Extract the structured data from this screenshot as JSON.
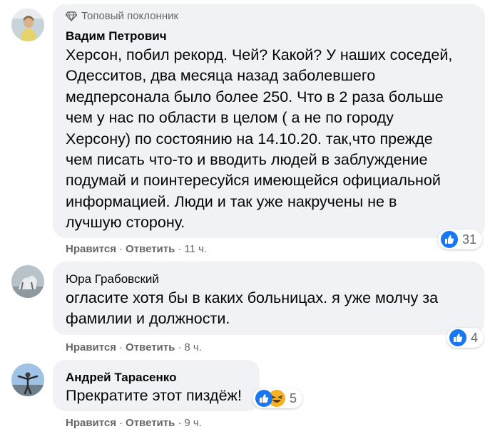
{
  "colors": {
    "like_blue": "#1877f2",
    "haha_yellow": "#f7b125",
    "bubble_bg": "#f0f2f5",
    "meta_gray": "#65676b"
  },
  "comments": [
    {
      "badge": "Топовый поклонник",
      "badge_icon": "diamond-icon",
      "author": "Вадим Петрович",
      "lines": [
        "Херсон, побил рекорд. Чей? Какой? У наших соседей,",
        "Одесситов, два месяца назад заболевшего",
        "медперсонала было более 250. Что в 2 раза больше",
        "чем у нас по области в целом ( а не по городу",
        "Херсону) по состоянию на 14.10.20. так,что прежде",
        "чем писать что-то и вводить людей в заблуждение",
        "подумай и поинтересуйся имеющейся официальной",
        "информацией. Люди и так уже накручены не в",
        "лучшую сторону."
      ],
      "like_label": "Нравится",
      "reply_label": "Ответить",
      "time": "11 ч.",
      "reaction_count": "31",
      "reaction_icons": [
        "like-icon"
      ]
    },
    {
      "author": "Юра Грабовский",
      "lines": [
        "огласите хотя бы в каких больницах. я уже молчу за",
        "фамилии и должности."
      ],
      "like_label": "Нравится",
      "reply_label": "Ответить",
      "time": "8 ч.",
      "reaction_count": "4",
      "reaction_icons": [
        "like-icon"
      ]
    },
    {
      "author": "Андрей Тарасенко",
      "lines": [
        "Прекратите этот пиздёж!"
      ],
      "like_label": "Нравится",
      "reply_label": "Ответить",
      "time": "9 ч.",
      "reaction_count": "5",
      "reaction_icons": [
        "like-icon",
        "haha-icon"
      ]
    }
  ]
}
